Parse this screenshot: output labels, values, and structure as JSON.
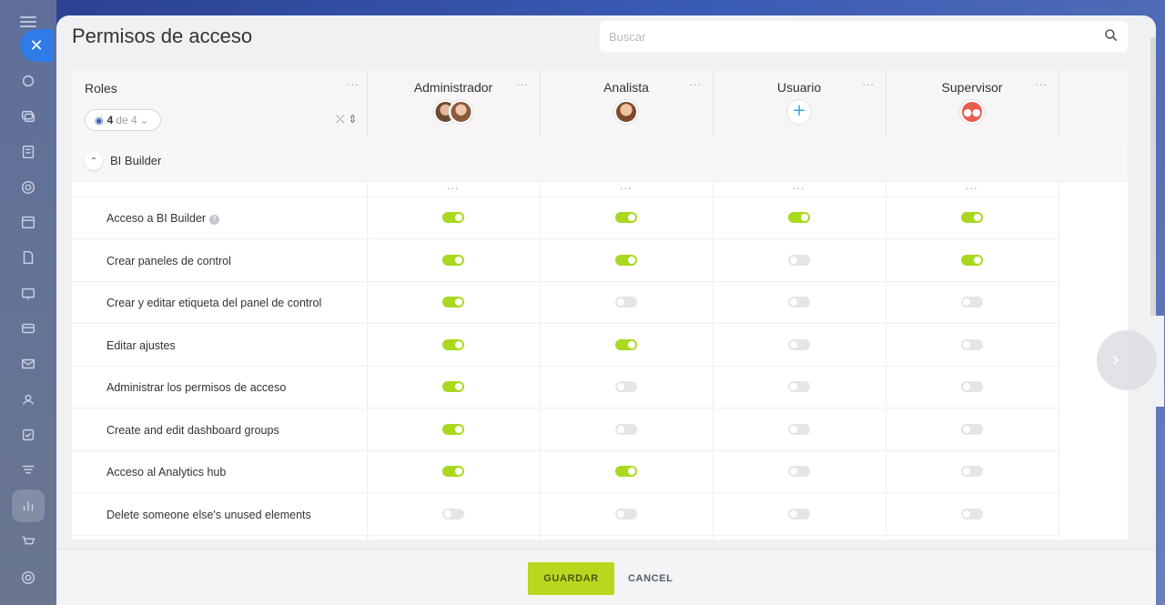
{
  "panel": {
    "title": "Permisos de acceso",
    "search_placeholder": "Buscar"
  },
  "roles_header": {
    "label": "Roles",
    "filter_count": "4",
    "filter_of": "de 4",
    "menu": "···"
  },
  "roles": [
    {
      "name": "Administrador",
      "menu": "···"
    },
    {
      "name": "Analista",
      "menu": "···"
    },
    {
      "name": "Usuario",
      "menu": "···"
    },
    {
      "name": "Supervisor",
      "menu": "···"
    }
  ],
  "section": {
    "title": "BI Builder",
    "column_menu": "···"
  },
  "permissions": [
    {
      "label": "Acceso a BI Builder",
      "help": "?",
      "values": [
        true,
        true,
        true,
        true
      ]
    },
    {
      "label": "Crear paneles de control",
      "values": [
        true,
        true,
        false,
        true
      ]
    },
    {
      "label": "Crear y editar etiqueta del panel de control",
      "values": [
        true,
        false,
        false,
        false
      ]
    },
    {
      "label": "Editar ajustes",
      "values": [
        true,
        true,
        false,
        false
      ]
    },
    {
      "label": "Administrar los permisos de acceso",
      "values": [
        true,
        false,
        false,
        false
      ]
    },
    {
      "label": "Create and edit dashboard groups",
      "values": [
        true,
        false,
        false,
        false
      ]
    },
    {
      "label": "Acceso al Analytics hub",
      "values": [
        true,
        true,
        false,
        false
      ]
    },
    {
      "label": "Delete someone else's unused elements",
      "values": [
        false,
        false,
        false,
        false
      ]
    }
  ],
  "footer": {
    "save_label": "GUARDAR",
    "cancel_label": "CANCEL"
  },
  "colors": {
    "toggle_on": "#a8d91f",
    "toggle_off": "#e4e5e7",
    "save_button": "#b8d71f",
    "close_button": "#2f7be8"
  },
  "icons": {
    "close": "close-icon",
    "search": "search-icon",
    "collapse": "chevron-up-icon",
    "next": "chevron-right-icon",
    "filter": "eye-icon",
    "sort": "sort-icon"
  }
}
